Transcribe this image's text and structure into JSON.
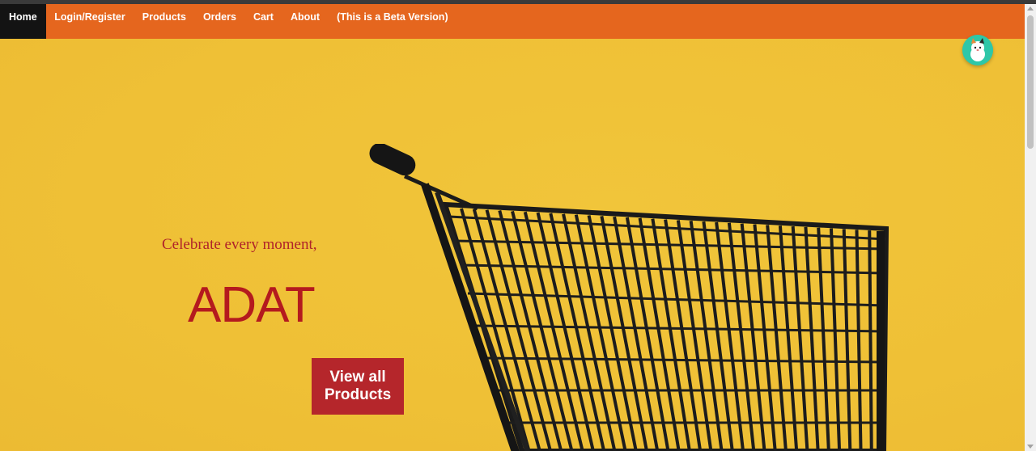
{
  "nav": {
    "items": [
      {
        "label": "Home",
        "active": true
      },
      {
        "label": "Login/Register",
        "active": false
      },
      {
        "label": "Products",
        "active": false
      },
      {
        "label": "Orders",
        "active": false
      },
      {
        "label": "Cart",
        "active": false
      },
      {
        "label": "About",
        "active": false
      },
      {
        "label": "(This is a Beta Version)",
        "active": false
      }
    ]
  },
  "hero": {
    "tagline": "Celebrate every moment,",
    "brand": "ADAT",
    "cta_label": "View all Products",
    "image_icon": "shopping-cart-icon"
  },
  "chat_widget": {
    "icon": "cat-mascot-icon"
  },
  "colors": {
    "navbar": "#e5661e",
    "nav_active": "#131313",
    "hero_bg": "#efc036",
    "brand_red": "#b41a1e",
    "cta_bg": "#b5262b"
  }
}
